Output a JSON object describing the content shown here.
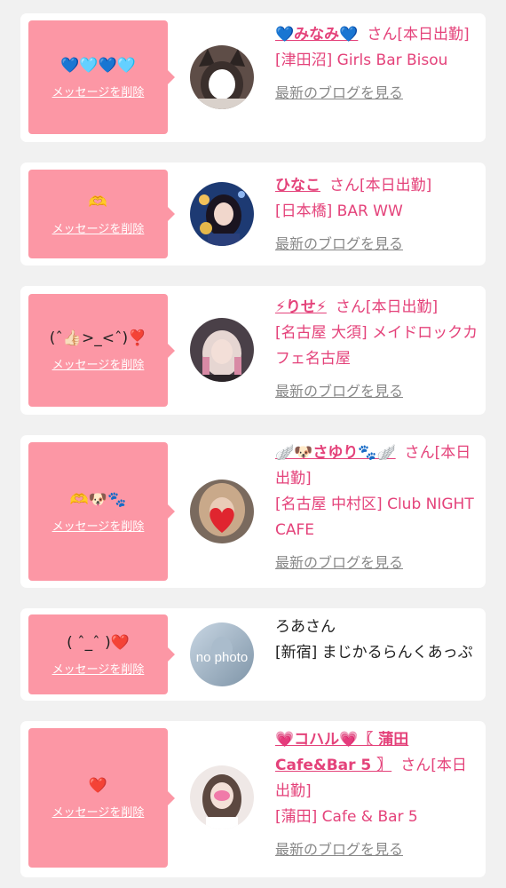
{
  "colors": {
    "card_bg": "#ffffff",
    "bubble_bg": "#fc97a5",
    "accent": "#e4427a",
    "link_gray": "#888888",
    "page_bg": "#f1f1f1"
  },
  "messages": [
    {
      "message": "💙🩵💙🩵",
      "delete_label": "メッセージを削除",
      "name": "💙みなみ💙",
      "honorific": "さん",
      "status": "[本日出勤]",
      "shop": "[津田沼] Girls Bar Bisou",
      "blog_label": "最新のブログを見る",
      "avatar_icon": "girl-with-animal-ears-photo"
    },
    {
      "message": "🫶",
      "delete_label": "メッセージを削除",
      "name": "ひなこ",
      "honorific": "さん",
      "status": "[本日出勤]",
      "shop": "[日本橋] BAR WW",
      "blog_label": "最新のブログを見る",
      "avatar_icon": "girl-dark-hair-photo"
    },
    {
      "message": "(ˆ👍🏻>_<ˆ)❣️",
      "delete_label": "メッセージを削除",
      "name": "⚡りせ⚡",
      "honorific": "さん",
      "status": "[本日出勤]",
      "shop": "[名古屋 大須] メイドロックカフェ名古屋",
      "blog_label": "最新のブログを見る",
      "avatar_icon": "girl-blonde-photo"
    },
    {
      "message": "🫶🐶🐾",
      "delete_label": "メッセージを削除",
      "name": "🪽🐶さゆり🐾🪽",
      "honorific": "さん",
      "status": "[本日出勤]",
      "shop": "[名古屋 中村区] Club NIGHT CAFE",
      "blog_label": "最新のブログを見る",
      "avatar_icon": "heart-over-face-photo"
    },
    {
      "message": "( ˆ_ˆ )❤️",
      "delete_label": "メッセージを削除",
      "name": "ろあ",
      "honorific": "さん",
      "status": "",
      "shop": "[新宿] まじかるらんくあっぷ",
      "blog_label": "",
      "avatar_icon": "no-photo-placeholder",
      "avatar_text": "no photo"
    },
    {
      "message": "❤️",
      "delete_label": "メッセージを削除",
      "name": "💗コハル💗〖 蒲田Cafe&Bar 5 〗",
      "honorific": "さん",
      "status": "[本日出勤]",
      "shop": "[蒲田] Cafe & Bar 5",
      "blog_label": "最新のブログを見る",
      "avatar_icon": "girl-pink-mask-photo"
    }
  ]
}
